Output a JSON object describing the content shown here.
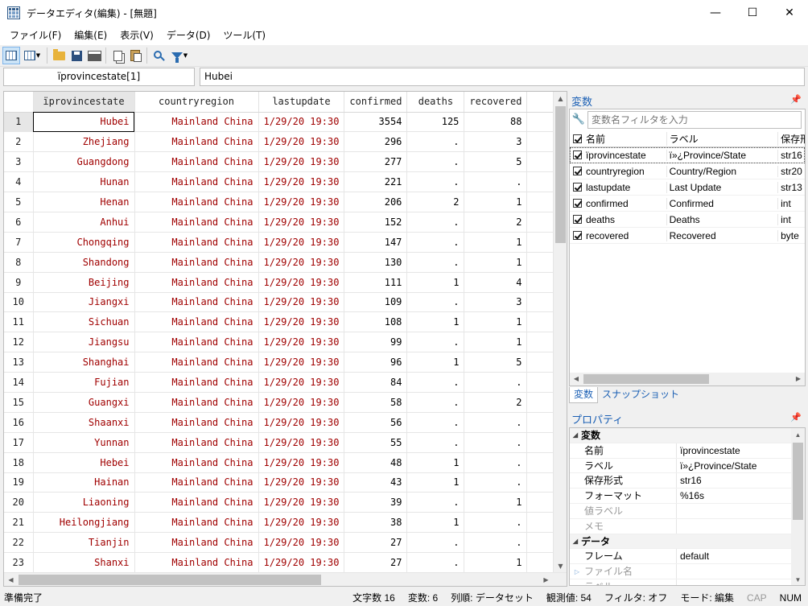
{
  "window": {
    "title": "データエディタ(編集) - [無題]",
    "controls": {
      "minimize": "—",
      "maximize": "☐",
      "close": "✕"
    }
  },
  "menu": [
    "ファイル(F)",
    "編集(E)",
    "表示(V)",
    "データ(D)",
    "ツール(T)"
  ],
  "toolbar": {
    "icons": [
      "grid-edit-icon",
      "grid-browse-icon",
      "open-folder-icon",
      "save-icon",
      "print-icon",
      "copy-icon",
      "paste-icon",
      "search-icon",
      "filter-icon"
    ]
  },
  "refbar": {
    "cell_name": "ïprovincestate[1]",
    "cell_value": "Hubei"
  },
  "grid": {
    "columns": [
      "ïprovincestate",
      "countryregion",
      "lastupdate",
      "confirmed",
      "deaths",
      "recovered"
    ],
    "rows": [
      {
        "n": "1",
        "province": "Hubei",
        "country": "Mainland China",
        "update": "1/29/20 19:30",
        "confirmed": "3554",
        "deaths": "125",
        "recovered": "88"
      },
      {
        "n": "2",
        "province": "Zhejiang",
        "country": "Mainland China",
        "update": "1/29/20 19:30",
        "confirmed": "296",
        "deaths": ".",
        "recovered": "3"
      },
      {
        "n": "3",
        "province": "Guangdong",
        "country": "Mainland China",
        "update": "1/29/20 19:30",
        "confirmed": "277",
        "deaths": ".",
        "recovered": "5"
      },
      {
        "n": "4",
        "province": "Hunan",
        "country": "Mainland China",
        "update": "1/29/20 19:30",
        "confirmed": "221",
        "deaths": ".",
        "recovered": "."
      },
      {
        "n": "5",
        "province": "Henan",
        "country": "Mainland China",
        "update": "1/29/20 19:30",
        "confirmed": "206",
        "deaths": "2",
        "recovered": "1"
      },
      {
        "n": "6",
        "province": "Anhui",
        "country": "Mainland China",
        "update": "1/29/20 19:30",
        "confirmed": "152",
        "deaths": ".",
        "recovered": "2"
      },
      {
        "n": "7",
        "province": "Chongqing",
        "country": "Mainland China",
        "update": "1/29/20 19:30",
        "confirmed": "147",
        "deaths": ".",
        "recovered": "1"
      },
      {
        "n": "8",
        "province": "Shandong",
        "country": "Mainland China",
        "update": "1/29/20 19:30",
        "confirmed": "130",
        "deaths": ".",
        "recovered": "1"
      },
      {
        "n": "9",
        "province": "Beijing",
        "country": "Mainland China",
        "update": "1/29/20 19:30",
        "confirmed": "111",
        "deaths": "1",
        "recovered": "4"
      },
      {
        "n": "10",
        "province": "Jiangxi",
        "country": "Mainland China",
        "update": "1/29/20 19:30",
        "confirmed": "109",
        "deaths": ".",
        "recovered": "3"
      },
      {
        "n": "11",
        "province": "Sichuan",
        "country": "Mainland China",
        "update": "1/29/20 19:30",
        "confirmed": "108",
        "deaths": "1",
        "recovered": "1"
      },
      {
        "n": "12",
        "province": "Jiangsu",
        "country": "Mainland China",
        "update": "1/29/20 19:30",
        "confirmed": "99",
        "deaths": ".",
        "recovered": "1"
      },
      {
        "n": "13",
        "province": "Shanghai",
        "country": "Mainland China",
        "update": "1/29/20 19:30",
        "confirmed": "96",
        "deaths": "1",
        "recovered": "5"
      },
      {
        "n": "14",
        "province": "Fujian",
        "country": "Mainland China",
        "update": "1/29/20 19:30",
        "confirmed": "84",
        "deaths": ".",
        "recovered": "."
      },
      {
        "n": "15",
        "province": "Guangxi",
        "country": "Mainland China",
        "update": "1/29/20 19:30",
        "confirmed": "58",
        "deaths": ".",
        "recovered": "2"
      },
      {
        "n": "16",
        "province": "Shaanxi",
        "country": "Mainland China",
        "update": "1/29/20 19:30",
        "confirmed": "56",
        "deaths": ".",
        "recovered": "."
      },
      {
        "n": "17",
        "province": "Yunnan",
        "country": "Mainland China",
        "update": "1/29/20 19:30",
        "confirmed": "55",
        "deaths": ".",
        "recovered": "."
      },
      {
        "n": "18",
        "province": "Hebei",
        "country": "Mainland China",
        "update": "1/29/20 19:30",
        "confirmed": "48",
        "deaths": "1",
        "recovered": "."
      },
      {
        "n": "19",
        "province": "Hainan",
        "country": "Mainland China",
        "update": "1/29/20 19:30",
        "confirmed": "43",
        "deaths": "1",
        "recovered": "."
      },
      {
        "n": "20",
        "province": "Liaoning",
        "country": "Mainland China",
        "update": "1/29/20 19:30",
        "confirmed": "39",
        "deaths": ".",
        "recovered": "1"
      },
      {
        "n": "21",
        "province": "Heilongjiang",
        "country": "Mainland China",
        "update": "1/29/20 19:30",
        "confirmed": "38",
        "deaths": "1",
        "recovered": "."
      },
      {
        "n": "22",
        "province": "Tianjin",
        "country": "Mainland China",
        "update": "1/29/20 19:30",
        "confirmed": "27",
        "deaths": ".",
        "recovered": "."
      },
      {
        "n": "23",
        "province": "Shanxi",
        "country": "Mainland China",
        "update": "1/29/20 19:30",
        "confirmed": "27",
        "deaths": ".",
        "recovered": "1"
      }
    ]
  },
  "variables_panel": {
    "title": "変数",
    "filter_placeholder": "変数名フィルタを入力",
    "headers": {
      "name": "名前",
      "label": "ラベル",
      "type": "保存形"
    },
    "items": [
      {
        "name": "ïprovincestate",
        "label": "ï»¿Province/State",
        "type": "str16"
      },
      {
        "name": "countryregion",
        "label": "Country/Region",
        "type": "str20"
      },
      {
        "name": "lastupdate",
        "label": "Last Update",
        "type": "str13"
      },
      {
        "name": "confirmed",
        "label": "Confirmed",
        "type": "int"
      },
      {
        "name": "deaths",
        "label": "Deaths",
        "type": "int"
      },
      {
        "name": "recovered",
        "label": "Recovered",
        "type": "byte"
      }
    ],
    "tabs": [
      "変数",
      "スナップショット"
    ]
  },
  "properties_panel": {
    "title": "プロパティ",
    "groups": [
      {
        "name": "変数",
        "rows": [
          {
            "key": "名前",
            "value": "ïprovincestate"
          },
          {
            "key": "ラベル",
            "value": "ï»¿Province/State"
          },
          {
            "key": "保存形式",
            "value": "str16"
          },
          {
            "key": "フォーマット",
            "value": "%16s"
          },
          {
            "key": "値ラベル",
            "value": ""
          },
          {
            "key": "メモ",
            "value": ""
          }
        ]
      },
      {
        "name": "データ",
        "rows": [
          {
            "key": "フレーム",
            "value": "default"
          },
          {
            "key": "ファイル名",
            "value": ""
          },
          {
            "key": "ラベル",
            "value": ""
          }
        ]
      }
    ]
  },
  "status": {
    "left": "準備完了",
    "items": [
      "文字数 16",
      "変数: 6",
      "列順: データセット",
      "観測値: 54",
      "フィルタ: オフ",
      "モード: 編集",
      "CAP",
      "NUM"
    ]
  }
}
